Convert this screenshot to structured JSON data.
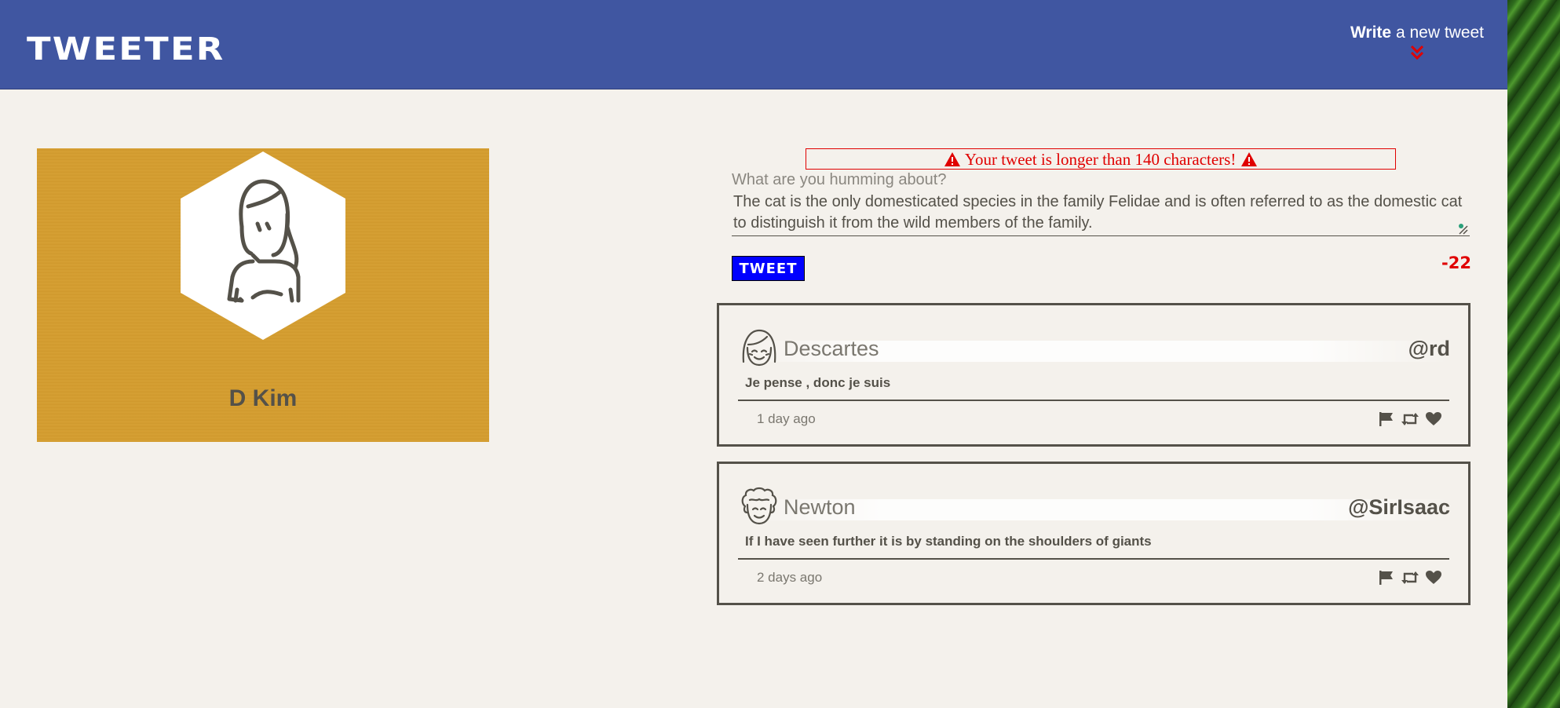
{
  "nav": {
    "brand": "TWEETER",
    "compose_bold": "Write",
    "compose_rest": " a new tweet",
    "compose_icon": "double-chevron-down-icon",
    "compose_icon_color": "#e00000"
  },
  "profile": {
    "name": "D Kim",
    "avatar_icon": "woman-avatar-icon"
  },
  "compose": {
    "error": "Your tweet is longer than 140 characters!",
    "error_icon": "warning-triangle-icon",
    "label": "What are you humming about?",
    "text": "The cat is the only domesticated species in the family Felidae and is often referred to as the domestic cat to distinguish it from the wild members of the family.",
    "button": "TWEET",
    "counter": "-22"
  },
  "tweets": [
    {
      "name": "Descartes",
      "handle": "@rd",
      "avatar_icon": "smiling-bob-hair-avatar-icon",
      "content": "Je pense , donc je suis",
      "time": "1 day ago"
    },
    {
      "name": "Newton",
      "handle": "@SirIsaac",
      "avatar_icon": "curly-hair-avatar-icon",
      "content": "If I have seen further it is by standing on the shoulders of giants",
      "time": "2 days ago"
    }
  ],
  "actions": [
    "flag-icon",
    "retweet-icon",
    "heart-icon"
  ],
  "colors": {
    "nav": "#4056a1",
    "background": "#f4f1ec",
    "profile_card": "#d29a2f",
    "text": "#545149",
    "error": "#e00000",
    "tweet_button": "#0000ff"
  }
}
